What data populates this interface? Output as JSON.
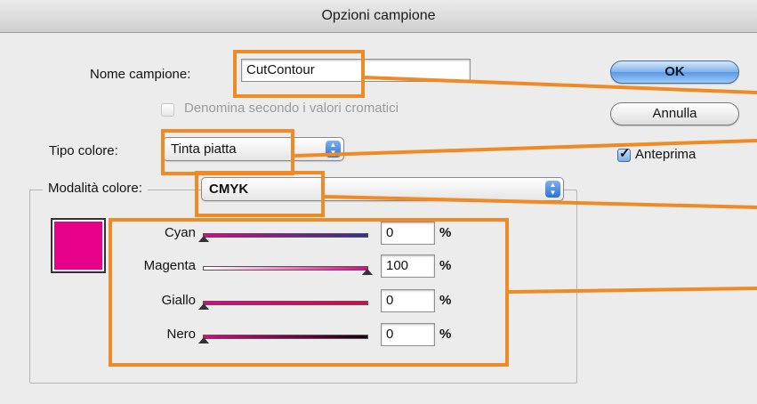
{
  "window": {
    "title": "Opzioni campione"
  },
  "swatch_name": {
    "label": "Nome campione:",
    "value": "CutContour"
  },
  "name_by_values": {
    "label": "Denomina secondo i valori cromatici",
    "checked": false,
    "enabled": false
  },
  "color_type": {
    "label": "Tipo colore:",
    "value": "Tinta piatta"
  },
  "color_mode": {
    "label": "Modalità colore:",
    "value": "CMYK"
  },
  "swatch_color": "#e6008a",
  "channels": [
    {
      "name": "Cyan",
      "value": "0",
      "unit": "%",
      "level": 0
    },
    {
      "name": "Magenta",
      "value": "100",
      "unit": "%",
      "level": 100
    },
    {
      "name": "Giallo",
      "value": "0",
      "unit": "%",
      "level": 0
    },
    {
      "name": "Nero",
      "value": "0",
      "unit": "%",
      "level": 0
    }
  ],
  "buttons": {
    "ok": "OK",
    "cancel": "Annulla"
  },
  "preview": {
    "label": "Anteprima",
    "checked": true
  },
  "annotation_color": "#f08a24"
}
